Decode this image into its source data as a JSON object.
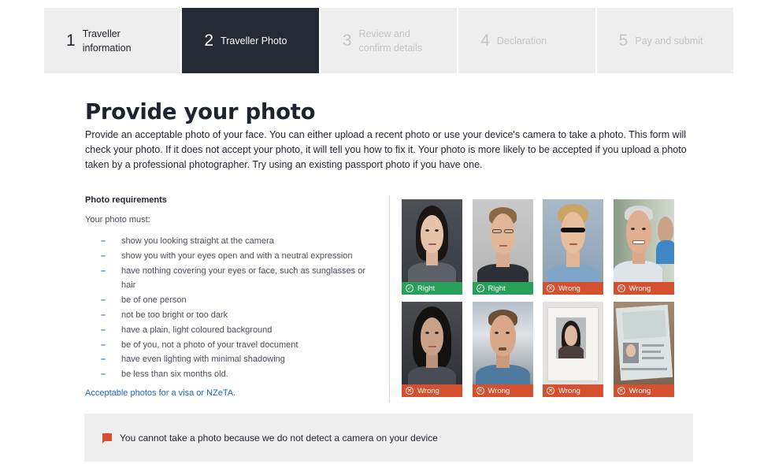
{
  "steps": [
    {
      "num": "1",
      "label": "Traveller\ninformation",
      "state": "done"
    },
    {
      "num": "2",
      "label": "Traveller Photo",
      "state": "active"
    },
    {
      "num": "3",
      "label": "Review and\nconfirm details",
      "state": "future"
    },
    {
      "num": "4",
      "label": "Declaration",
      "state": "future"
    },
    {
      "num": "5",
      "label": "Pay and submit",
      "state": "future"
    }
  ],
  "page": {
    "title": "Provide your photo",
    "intro": "Provide an acceptable photo of your face. You can either upload a recent photo or use your device's camera to take a photo. This form will check your photo. If it does not accept your photo, it will tell you how to fix it. Your photo is more likely to be accepted if you upload a photo taken by a professional photographer. Try using an existing passport photo if you have one."
  },
  "requirements": {
    "title": "Photo requirements",
    "lead": "Your photo must:",
    "items": [
      "show you looking straight at the camera",
      "show you with your eyes open and with a neutral expression",
      "have nothing covering your eyes or face, such as sunglasses or hair",
      "be of one person",
      "not be too bright or too dark",
      "have a plain, light coloured background",
      "be of you, not a photo of your travel document",
      "have even lighting with minimal shadowing",
      "be less than six months old."
    ],
    "link": "Acceptable photos for a visa or NZeTA."
  },
  "photos": [
    {
      "label": "Right",
      "status": "ok"
    },
    {
      "label": "Right",
      "status": "ok"
    },
    {
      "label": "Wrong",
      "status": "bad"
    },
    {
      "label": "Wrong",
      "status": "bad"
    },
    {
      "label": "Wrong",
      "status": "bad"
    },
    {
      "label": "Wrong",
      "status": "bad"
    },
    {
      "label": "Wrong",
      "status": "bad"
    },
    {
      "label": "Wrong",
      "status": "bad"
    }
  ],
  "notice": {
    "text": "You cannot take a photo because we do not detect a camera on your device"
  },
  "colors": {
    "active_step": "#262a33",
    "right": "#28a05a",
    "wrong": "#d4502e",
    "link": "#1a66c2"
  }
}
